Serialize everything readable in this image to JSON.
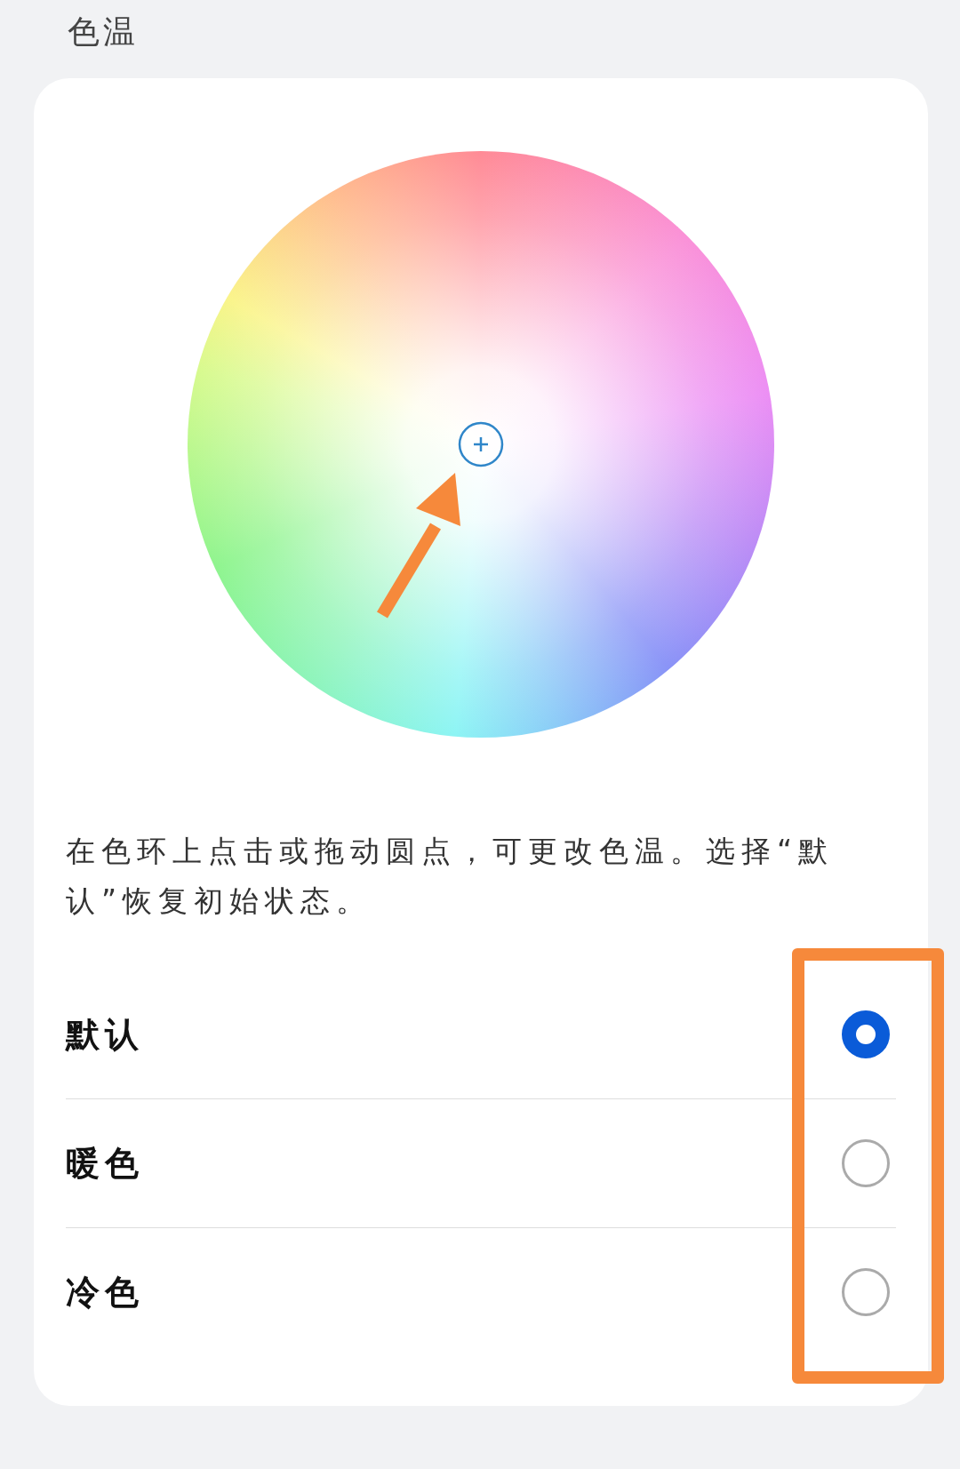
{
  "title": "色温",
  "description": "在色环上点击或拖动圆点，可更改色温。选择“默认”恢复初始状态。",
  "options": [
    {
      "label": "默认",
      "selected": true
    },
    {
      "label": "暖色",
      "selected": false
    },
    {
      "label": "冷色",
      "selected": false
    }
  ],
  "annotations": {
    "arrow": true,
    "highlight_frame": true
  }
}
